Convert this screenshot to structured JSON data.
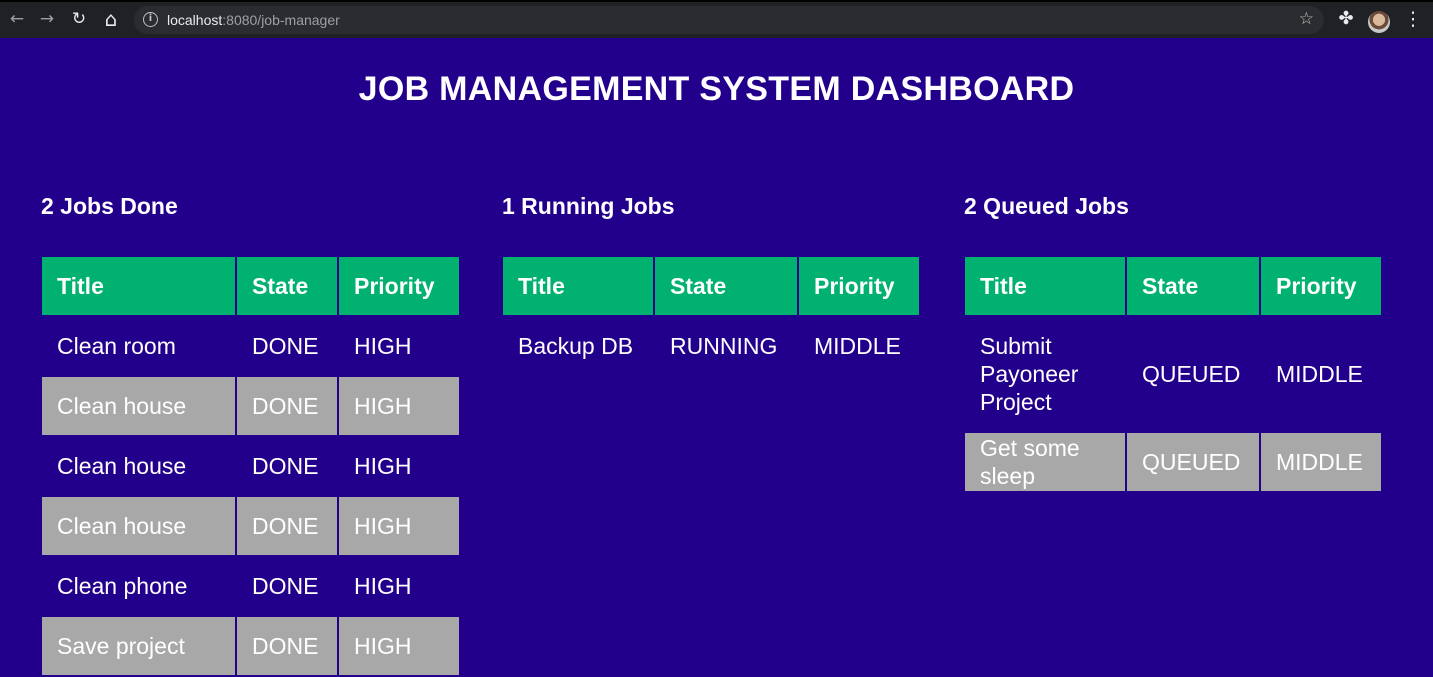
{
  "browser": {
    "url_host": "localhost",
    "url_rest": ":8080/job-manager",
    "back_icon": "←",
    "forward_icon": "→",
    "reload_icon": "↻",
    "home_icon": "⌂",
    "star_icon": "☆",
    "extensions_icon": "✤",
    "menu_icon": "⋮"
  },
  "page": {
    "title": "JOB MANAGEMENT SYSTEM DASHBOARD"
  },
  "columns": [
    "Title",
    "State",
    "Priority"
  ],
  "panels": {
    "done": {
      "heading": "2 Jobs Done",
      "rows": [
        [
          "Clean room",
          "DONE",
          "HIGH"
        ],
        [
          "Clean house",
          "DONE",
          "HIGH"
        ],
        [
          "Clean house",
          "DONE",
          "HIGH"
        ],
        [
          "Clean house",
          "DONE",
          "HIGH"
        ],
        [
          "Clean phone",
          "DONE",
          "HIGH"
        ],
        [
          "Save project",
          "DONE",
          "HIGH"
        ]
      ]
    },
    "running": {
      "heading": "1 Running Jobs",
      "rows": [
        [
          "Backup DB",
          "RUNNING",
          "MIDDLE"
        ]
      ]
    },
    "queued": {
      "heading": "2 Queued Jobs",
      "rows": [
        [
          "Submit Payoneer Project",
          "QUEUED",
          "MIDDLE"
        ],
        [
          "Get some sleep",
          "QUEUED",
          "MIDDLE"
        ]
      ]
    }
  }
}
